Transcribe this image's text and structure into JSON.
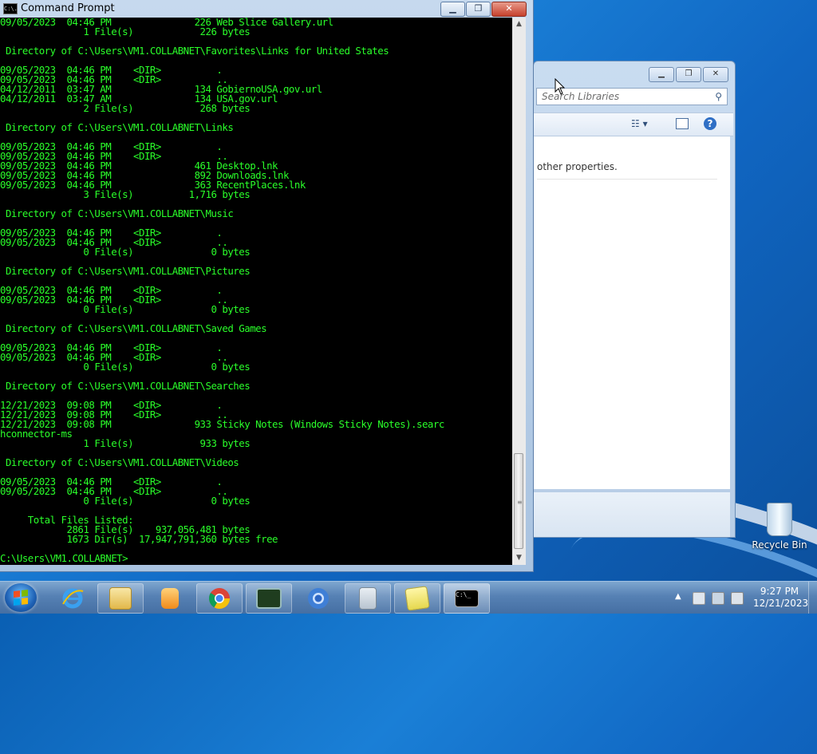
{
  "cmd": {
    "title": "Command Prompt",
    "icon_label": "C:\\.",
    "buttons": {
      "minimize": "▁",
      "maximize": "❐",
      "close": "✕"
    },
    "console_lines": [
      "09/05/2023  04:46 PM               226 Web Slice Gallery.url",
      "               1 File(s)            226 bytes",
      "",
      " Directory of C:\\Users\\VM1.COLLABNET\\Favorites\\Links for United States",
      "",
      "09/05/2023  04:46 PM    <DIR>          .",
      "09/05/2023  04:46 PM    <DIR>          ..",
      "04/12/2011  03:47 AM               134 GobiernoUSA.gov.url",
      "04/12/2011  03:47 AM               134 USA.gov.url",
      "               2 File(s)            268 bytes",
      "",
      " Directory of C:\\Users\\VM1.COLLABNET\\Links",
      "",
      "09/05/2023  04:46 PM    <DIR>          .",
      "09/05/2023  04:46 PM    <DIR>          ..",
      "09/05/2023  04:46 PM               461 Desktop.lnk",
      "09/05/2023  04:46 PM               892 Downloads.lnk",
      "09/05/2023  04:46 PM               363 RecentPlaces.lnk",
      "               3 File(s)          1,716 bytes",
      "",
      " Directory of C:\\Users\\VM1.COLLABNET\\Music",
      "",
      "09/05/2023  04:46 PM    <DIR>          .",
      "09/05/2023  04:46 PM    <DIR>          ..",
      "               0 File(s)              0 bytes",
      "",
      " Directory of C:\\Users\\VM1.COLLABNET\\Pictures",
      "",
      "09/05/2023  04:46 PM    <DIR>          .",
      "09/05/2023  04:46 PM    <DIR>          ..",
      "               0 File(s)              0 bytes",
      "",
      " Directory of C:\\Users\\VM1.COLLABNET\\Saved Games",
      "",
      "09/05/2023  04:46 PM    <DIR>          .",
      "09/05/2023  04:46 PM    <DIR>          ..",
      "               0 File(s)              0 bytes",
      "",
      " Directory of C:\\Users\\VM1.COLLABNET\\Searches",
      "",
      "12/21/2023  09:08 PM    <DIR>          .",
      "12/21/2023  09:08 PM    <DIR>          ..",
      "12/21/2023  09:08 PM               933 Sticky Notes (Windows Sticky Notes).searc",
      "hconnector-ms",
      "               1 File(s)            933 bytes",
      "",
      " Directory of C:\\Users\\VM1.COLLABNET\\Videos",
      "",
      "09/05/2023  04:46 PM    <DIR>          .",
      "09/05/2023  04:46 PM    <DIR>          ..",
      "               0 File(s)              0 bytes",
      "",
      "     Total Files Listed:",
      "            2861 File(s)    937,056,481 bytes",
      "            1673 Dir(s)  17,947,791,360 bytes free",
      "",
      "C:\\Users\\VM1.COLLABNET>"
    ]
  },
  "explorer": {
    "search_placeholder": "Search Libraries",
    "search_icon": "magnifier-icon",
    "content_text": "other properties."
  },
  "desktop": {
    "recycle_bin_label": "Recycle Bin"
  },
  "taskbar": {
    "items": [
      "internet-explorer",
      "windows-explorer",
      "media-player",
      "chrome",
      "task-manager",
      "chrome-alt",
      "calculator",
      "sticky-notes",
      "command-prompt"
    ],
    "clock": {
      "time": "9:27 PM",
      "date": "12/21/2023"
    }
  },
  "colors": {
    "console_text": "#2aff2a",
    "console_bg": "#000000"
  }
}
